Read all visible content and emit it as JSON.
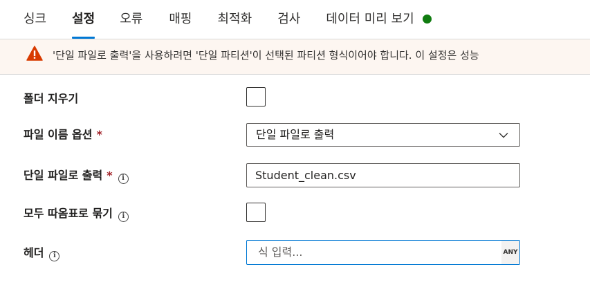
{
  "tabs": [
    {
      "label": "싱크"
    },
    {
      "label": "설정",
      "active": true
    },
    {
      "label": "오류"
    },
    {
      "label": "매핑"
    },
    {
      "label": "최적화"
    },
    {
      "label": "검사"
    },
    {
      "label": "데이터 미리 보기",
      "status": "success"
    }
  ],
  "colors": {
    "accent": "#0078d4",
    "success": "#107c10",
    "warning": "#d83b01",
    "banner_bg": "#fdf6f1",
    "required": "#a4262c"
  },
  "banner": {
    "icon": "warning-icon",
    "text": "'단일 파일로 출력'을 사용하려면 '단일 파티션'이 선택된 파티션 형식이어야 합니다. 이 설정은 성능"
  },
  "form": {
    "clear_folder": {
      "label": "폴더 지우기",
      "checked": false
    },
    "file_name_option": {
      "label": "파일 이름 옵션",
      "required_mark": "*",
      "value": "단일 파일로 출력",
      "icon": "chevron-down-icon"
    },
    "output_single_file": {
      "label": "단일 파일로 출력",
      "required_mark": "*",
      "info_icon": "info-icon",
      "value": "Student_clean.csv"
    },
    "quote_all": {
      "label": "모두 따옴표로 묶기",
      "info_icon": "info-icon",
      "checked": false
    },
    "header": {
      "label": "헤더",
      "info_icon": "info-icon",
      "placeholder": "식 입력...",
      "type_badge": "ANY"
    }
  }
}
